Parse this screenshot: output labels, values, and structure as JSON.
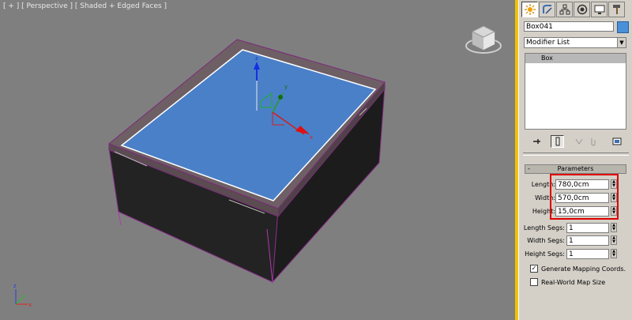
{
  "viewport": {
    "label": "[ + ] [ Perspective ] [ Shaded + Edged Faces ]",
    "axis_labels": {
      "z": "z",
      "x": "x",
      "y": "y"
    }
  },
  "command_panel": {
    "tabs": [
      {
        "name": "create-tab",
        "icon": "sun-star-icon",
        "active": true
      },
      {
        "name": "modify-tab",
        "icon": "modify-bend-icon",
        "active": false
      },
      {
        "name": "hierarchy-tab",
        "icon": "hierarchy-icon",
        "active": false
      },
      {
        "name": "motion-tab",
        "icon": "motion-circle-icon",
        "active": false
      },
      {
        "name": "display-tab",
        "icon": "monitor-icon",
        "active": false
      },
      {
        "name": "utilities-tab",
        "icon": "hammer-icon",
        "active": false
      }
    ],
    "object_name": "Box041",
    "object_color": "#4a90d9",
    "modifier_list": "Modifier List",
    "stack_items": [
      "Box"
    ],
    "rollout_title": "Parameters",
    "rollout_toggle": "-",
    "params": {
      "length_label": "Length:",
      "length_value": "780,0cm",
      "width_label": "Width:",
      "width_value": "570,0cm",
      "height_label": "Height:",
      "height_value": "15,0cm",
      "length_segs_label": "Length Segs:",
      "length_segs_value": "1",
      "width_segs_label": "Width Segs:",
      "width_segs_value": "1",
      "height_segs_label": "Height Segs:",
      "height_segs_value": "1"
    },
    "checks": {
      "gen_mapping_label": "Generate Mapping Coords.",
      "gen_mapping_checked": "✓",
      "real_world_label": "Real-World Map Size",
      "real_world_checked": ""
    },
    "highlight_color": "#e00000",
    "accent_color": "#f2c200"
  }
}
